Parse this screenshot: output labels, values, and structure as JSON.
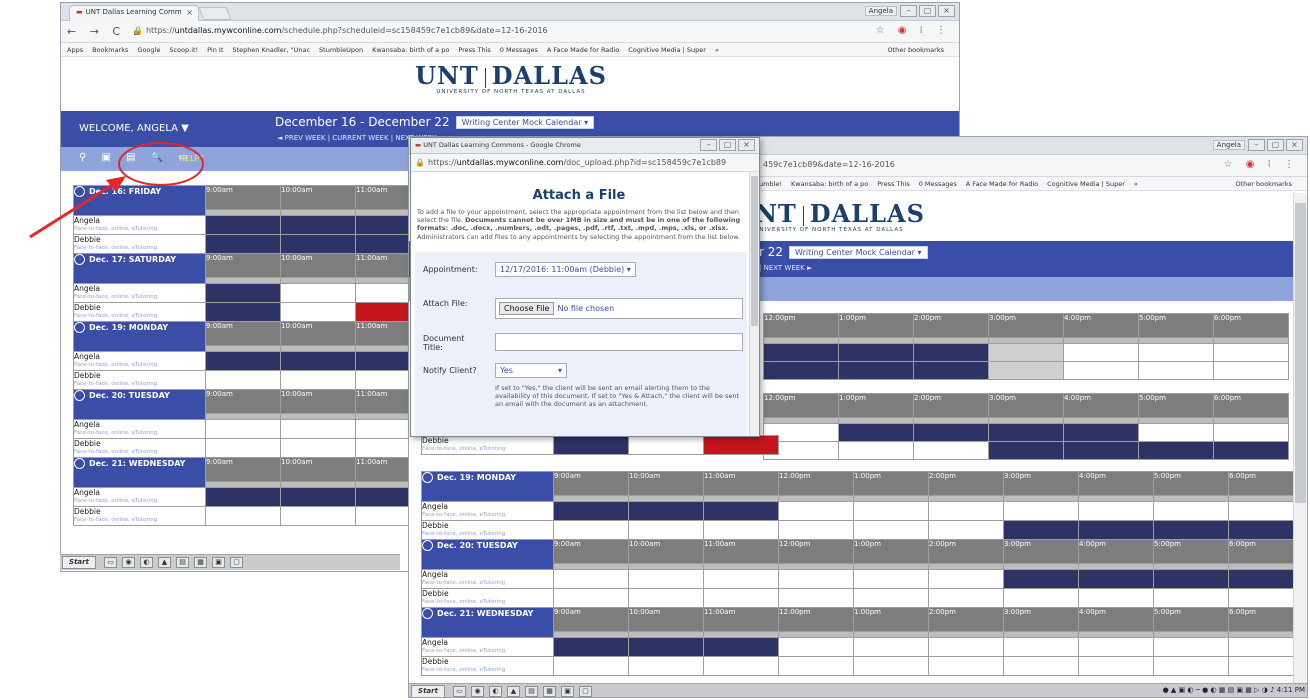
{
  "back_window": {
    "tab_title": "UNT Dallas Learning Comm",
    "url_scheme": "https://",
    "url_host": "untdallas.mywconline.com",
    "url_path": "/schedule.php?scheduleid=sc158459c7e1cb89&date=12-16-2016",
    "user_badge": "Angela",
    "bookmarks": [
      "Apps",
      "Bookmarks",
      "Google",
      "Scoop.it!",
      "Pin It",
      "Stephen Knadler, \"Unac",
      "StumbleUpon",
      "Kwansaba: birth of a po",
      "Press This",
      "0 Messages",
      "A Face Made for Radio",
      "Cognitive Media | Super"
    ],
    "bookmarks_more": "»",
    "other_bookmarks": "Other bookmarks",
    "welcome": "WELCOME, ANGELA",
    "welcome_caret": "▼",
    "week_range": "December 16 - December 22",
    "calendar_select": "Writing Center Mock Calendar",
    "week_nav": "◄ PREV WEEK | CURRENT WEEK | NEXT WEEK ►",
    "help_label": "HELP?",
    "times": [
      "9:00am",
      "10:00am",
      "11:00am"
    ],
    "days": [
      {
        "label": "Dec. 16: FRIDAY",
        "rows": [
          [
            "busy",
            "busy",
            "busy"
          ],
          [
            "busy",
            "busy",
            "busy"
          ]
        ]
      },
      {
        "label": "Dec. 17: SATURDAY",
        "rows": [
          [
            "busy",
            "free",
            "free"
          ],
          [
            "busy",
            "free",
            "red"
          ]
        ]
      },
      {
        "label": "Dec. 19: MONDAY",
        "rows": [
          [
            "busy",
            "busy",
            "busy"
          ],
          [
            "free",
            "free",
            "free"
          ]
        ]
      },
      {
        "label": "Dec. 20: TUESDAY",
        "rows": [
          [
            "free",
            "free",
            "free"
          ],
          [
            "free",
            "free",
            "free"
          ]
        ]
      },
      {
        "label": "Dec. 21: WEDNESDAY",
        "rows": [
          [
            "busy",
            "busy",
            "busy"
          ],
          [
            "free",
            "free",
            "free"
          ]
        ]
      }
    ]
  },
  "front_window": {
    "url_path_partial": "459c7e1cb89&date=12-16-2016",
    "user_badge": "Angela",
    "bookmarks": [
      "umble!",
      "Kwansaba: birth of a po",
      "Press This",
      "0 Messages",
      "A Face Made for Radio",
      "Cognitive Media | Super"
    ],
    "bookmarks_more": "»",
    "other_bookmarks": "Other bookmarks",
    "week_range_partial": "r 22",
    "calendar_select": "Writing Center Mock Calendar",
    "week_nav_partial": "| NEXT WEEK ►",
    "times_top": [
      "12:00pm",
      "1:00pm",
      "2:00pm",
      "3:00pm",
      "4:00pm",
      "5:00pm",
      "6:00pm"
    ],
    "times": [
      "9:00am",
      "10:00am",
      "11:00am",
      "12:00pm",
      "1:00pm",
      "2:00pm",
      "3:00pm",
      "4:00pm",
      "5:00pm",
      "6:00pm"
    ],
    "days": [
      {
        "label": "Dec. 19: MONDAY",
        "rows": [
          [
            "busy",
            "busy",
            "busy",
            "free",
            "free",
            "free",
            "free",
            "free",
            "free",
            "free"
          ],
          [
            "free",
            "free",
            "free",
            "free",
            "free",
            "free",
            "busy",
            "busy",
            "busy",
            "busy"
          ]
        ]
      },
      {
        "label": "Dec. 20: TUESDAY",
        "rows": [
          [
            "free",
            "free",
            "free",
            "free",
            "free",
            "free",
            "busy",
            "busy",
            "busy",
            "busy"
          ],
          [
            "free",
            "free",
            "free",
            "free",
            "free",
            "free",
            "free",
            "free",
            "free",
            "free"
          ]
        ]
      },
      {
        "label": "Dec. 21: WEDNESDAY",
        "rows": [
          [
            "busy",
            "busy",
            "busy",
            "free",
            "free",
            "free",
            "free",
            "free",
            "free",
            "free"
          ],
          [
            "free",
            "free",
            "free",
            "free",
            "free",
            "free",
            "free",
            "free",
            "free",
            "free"
          ]
        ]
      }
    ],
    "top_rows": [
      [
        "busy",
        "busy",
        "busy",
        "busy",
        "busy",
        "grey",
        "free",
        "free",
        "free"
      ],
      [
        "busy",
        "busy",
        "busy",
        "busy",
        "busy",
        "grey",
        "free",
        "free",
        "free"
      ]
    ],
    "sat_rows": [
      [
        "free",
        "free",
        "free",
        "free",
        "busy",
        "busy",
        "busy",
        "busy"
      ],
      [
        "busy",
        "free",
        "red",
        "free",
        "free",
        "free",
        "busy",
        "busy",
        "busy",
        "busy"
      ]
    ]
  },
  "people": [
    {
      "name": "Angela",
      "sub": "Face-to-face, online, eTutoring"
    },
    {
      "name": "Debbie",
      "sub": "Face-to-face, online, eTutoring"
    }
  ],
  "logo": {
    "left": "UNT",
    "right": "DALLAS",
    "tagline": "UNIVERSITY OF NORTH TEXAS AT DALLAS"
  },
  "dialog": {
    "window_title": "UNT Dallas Learning Commons - Google Chrome",
    "url_scheme": "https://",
    "url_host": "untdallas.mywconline.com",
    "url_path": "/doc_upload.php?id=sc158459c7e1cb89",
    "heading": "Attach a File",
    "description_1": "To add a file to your appointment, select the appropriate appointment from the list below and then select the file.",
    "description_2": "Documents cannot be over 1MB in size and must be in one of the following formats: .doc, .docx, .numbers, .odt, .pages, .pdf, .rtf, .txt, .mpd, .mps, .xls, or .xlsx.",
    "description_3": "Administrators can add files to any appointments by selecting the appointment from the list below.",
    "appointment_label": "Appointment:",
    "appointment_value": "12/17/2016: 11:00am (Debbie) ▾",
    "attach_label": "Attach File:",
    "choose_file": "Choose File",
    "no_file": "No file chosen",
    "doc_title_label_1": "Document",
    "doc_title_label_2": "Title:",
    "doc_title_value": "",
    "notify_label": "Notify Client?",
    "notify_value": "Yes",
    "notify_note": "If set to \"Yes,\" the client will be sent an email alerting them to the availability of this document. If set to \"Yes & Attach,\" the client will be sent an email with the document as an attachment."
  },
  "taskbar": {
    "start": "Start",
    "clock": "4:11 PM"
  }
}
